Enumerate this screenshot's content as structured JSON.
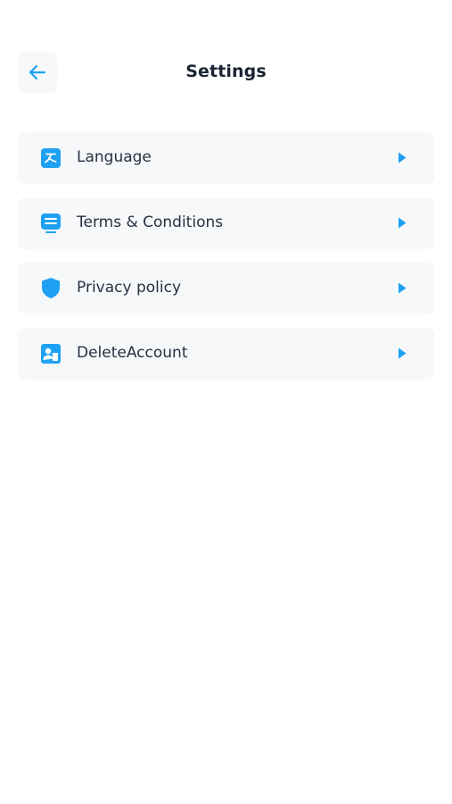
{
  "header": {
    "title": "Settings",
    "back_icon": "arrow-left-icon"
  },
  "menu": {
    "items": [
      {
        "label": "Language",
        "icon": "translate-icon"
      },
      {
        "label": "Terms & Conditions",
        "icon": "document-list-icon"
      },
      {
        "label": "Privacy policy",
        "icon": "shield-icon"
      },
      {
        "label": "DeleteAccount",
        "icon": "user-delete-icon"
      }
    ]
  },
  "colors": {
    "accent": "#1ea1f2",
    "card_bg": "#f6f8fa",
    "title_text": "#1a2433"
  }
}
